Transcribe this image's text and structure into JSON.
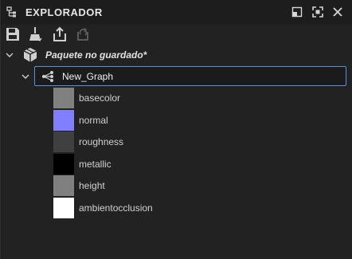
{
  "panel": {
    "title": "EXPLORADOR",
    "title_icon": "tree-hierarchy-icon",
    "header_buttons": [
      "restore-window-icon",
      "maximize-icon",
      "close-icon"
    ]
  },
  "toolbar": {
    "buttons": [
      "save-icon",
      "clean-broom-icon",
      "export-icon",
      "refresh-icon"
    ]
  },
  "tree": {
    "package": {
      "label": "Paquete no guardado*",
      "icon": "package-cube-icon",
      "expanded": true
    },
    "graph": {
      "label": "New_Graph",
      "icon": "graph-nodes-icon",
      "expanded": true,
      "selected": true
    },
    "outputs": [
      {
        "label": "basecolor",
        "color": "#808080"
      },
      {
        "label": "normal",
        "color": "#8080ff"
      },
      {
        "label": "roughness",
        "color": "#404040"
      },
      {
        "label": "metallic",
        "color": "#000000"
      },
      {
        "label": "height",
        "color": "#808080"
      },
      {
        "label": "ambientocclusion",
        "color": "#ffffff"
      }
    ]
  },
  "colors": {
    "background": "#222222",
    "header": "#1d1d1d",
    "selection_border": "#5b8fd6"
  }
}
